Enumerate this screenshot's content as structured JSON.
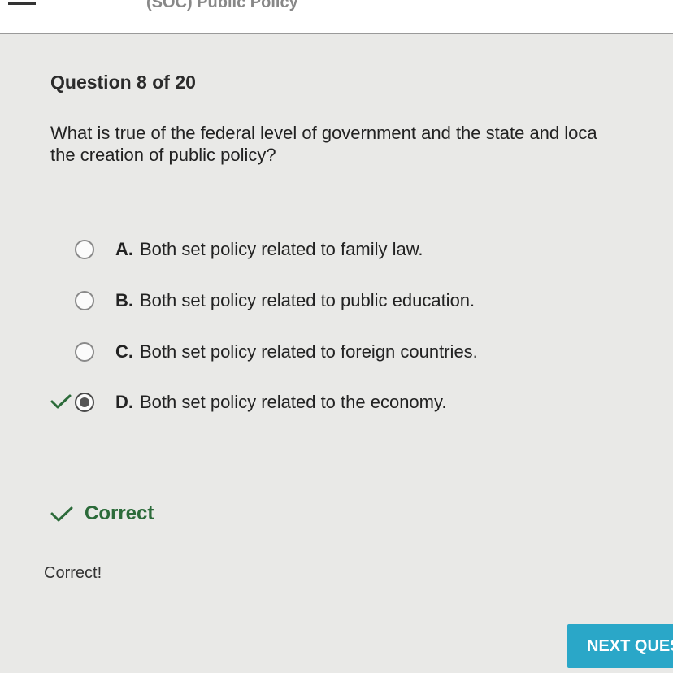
{
  "header": {
    "title": "(SOC) Public Policy"
  },
  "question": {
    "counter": "Question 8 of 20",
    "text_line1": "What is true of the federal level of government and the state and loca",
    "text_line2": "the creation of public policy?"
  },
  "options": [
    {
      "letter": "A.",
      "text": "Both set policy related to family law.",
      "selected": false
    },
    {
      "letter": "B.",
      "text": "Both set policy related to public education.",
      "selected": false
    },
    {
      "letter": "C.",
      "text": "Both set policy related to foreign countries.",
      "selected": false
    },
    {
      "letter": "D.",
      "text": "Both set policy related to the economy.",
      "selected": true
    }
  ],
  "result": {
    "status": "Correct",
    "feedback": "Correct!"
  },
  "footer": {
    "next_label": "NEXT QUES"
  },
  "colors": {
    "correct_green": "#2c6b3a",
    "button_blue": "#2aa7c8"
  }
}
